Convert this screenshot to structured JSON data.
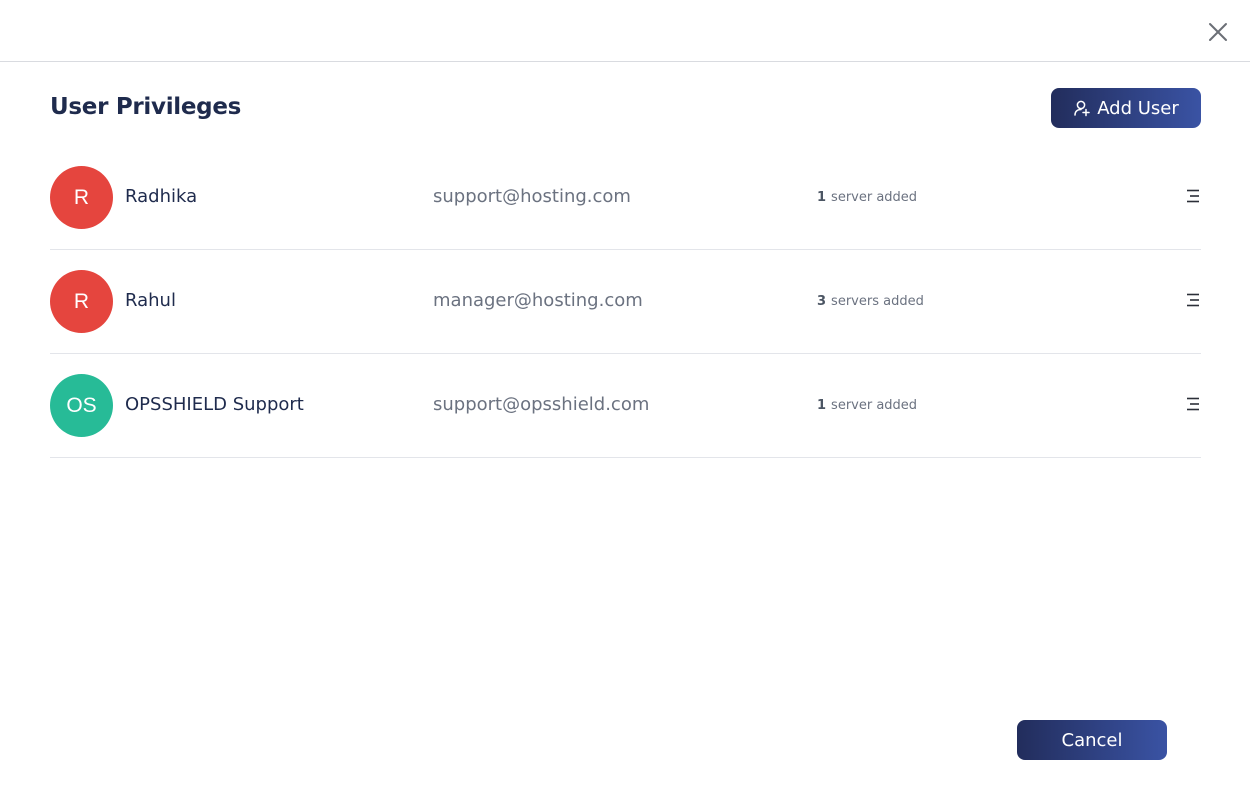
{
  "modal": {
    "title": "User Privileges",
    "add_user_label": "Add User",
    "cancel_label": "Cancel"
  },
  "users": [
    {
      "initials": "R",
      "name": "Radhika",
      "email": "support@hosting.com",
      "server_count": "1",
      "server_label": "server added",
      "avatar_color": "#e5453e"
    },
    {
      "initials": "R",
      "name": "Rahul",
      "email": "manager@hosting.com",
      "server_count": "3",
      "server_label": "servers added",
      "avatar_color": "#e5453e"
    },
    {
      "initials": "OS",
      "name": "OPSSHIELD Support",
      "email": "support@opsshield.com",
      "server_count": "1",
      "server_label": "server added",
      "avatar_color": "#27bb97"
    }
  ],
  "colors": {
    "primary_button": "#2c3d7e",
    "title_text": "#1f2b4d",
    "muted_text": "#6b7280"
  },
  "icons": {
    "close": "close-icon",
    "add_user": "user-plus-icon",
    "row_menu": "menu-lines-icon"
  }
}
